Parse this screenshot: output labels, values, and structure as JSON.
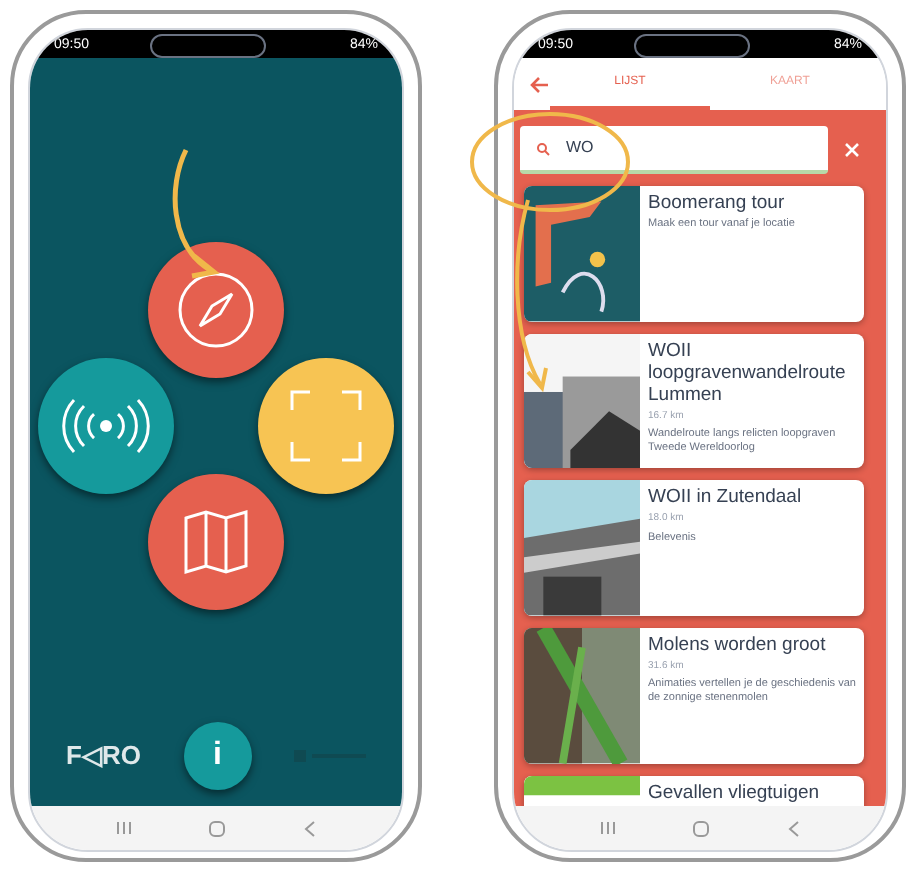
{
  "home_screen": {
    "status_bar": {
      "time": "09:50",
      "battery": "84%"
    },
    "logo": "F◁RO",
    "info_button": "i"
  },
  "list_screen": {
    "status_bar": {
      "time": "09:50",
      "battery": "84%"
    },
    "tabs": [
      {
        "label": "LIJST",
        "selected": true
      },
      {
        "label": "KAART",
        "selected": false
      }
    ],
    "search": {
      "value": "WO"
    },
    "results": [
      {
        "title": "Boomerang tour",
        "description": "Maak een tour vanaf je locatie"
      },
      {
        "title": "WOII loopgravenwandelroute Lummen",
        "distance": "16.7 km",
        "description": "Wandelroute langs relicten loopgraven Tweede Wereldoorlog"
      },
      {
        "title": "WOII in Zutendaal",
        "distance": "18.0 km",
        "description": "Belevenis"
      },
      {
        "title": "Molens worden groot",
        "distance": "31.6 km",
        "description": "Animaties vertellen je de geschiedenis van de zonnige stenenmolen"
      },
      {
        "title": "Gevallen vliegtuigen"
      }
    ]
  }
}
